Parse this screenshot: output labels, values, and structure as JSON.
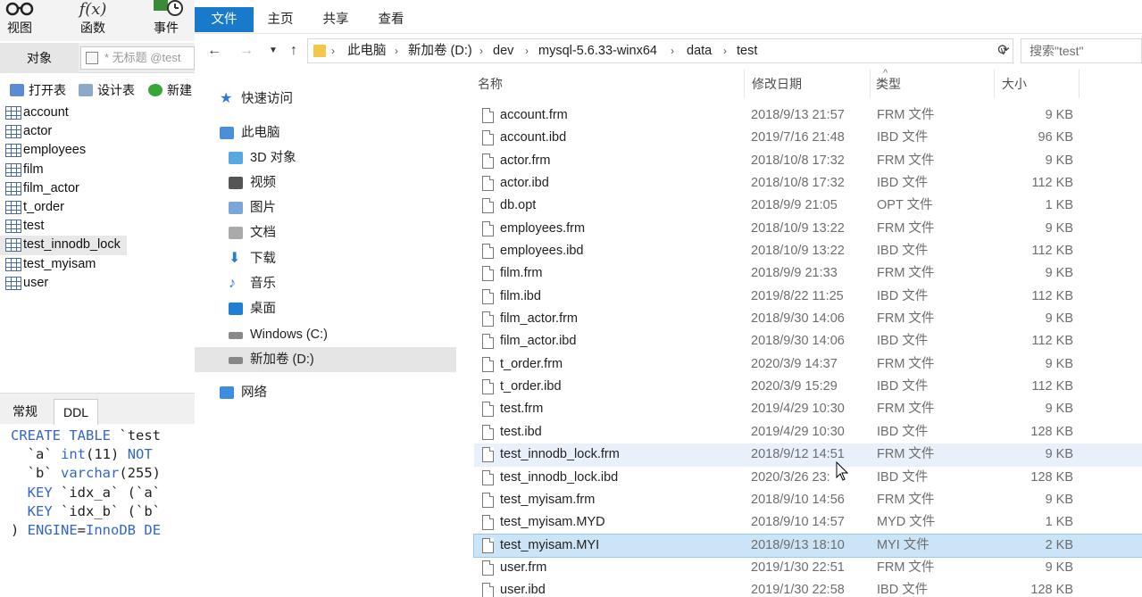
{
  "navicat": {
    "toolbar": [
      {
        "label": "视图",
        "icon": "glasses-icon"
      },
      {
        "label": "函数",
        "icon": "function-icon"
      },
      {
        "label": "事件",
        "icon": "clock-icon"
      }
    ],
    "object_tab": "对象",
    "table_tab_placeholder": "* 无标题 @test",
    "actions": [
      {
        "label": "打开表",
        "icon": "open-table-icon"
      },
      {
        "label": "设计表",
        "icon": "design-table-icon"
      },
      {
        "label": "新建",
        "icon": "new-table-icon"
      }
    ],
    "tables": [
      "account",
      "actor",
      "employees",
      "film",
      "film_actor",
      "t_order",
      "test",
      "test_innodb_lock",
      "test_myisam",
      "user"
    ],
    "selected_table": "test_innodb_lock",
    "bottom_tabs": [
      "常规",
      "DDL"
    ],
    "active_bottom_tab": "DDL",
    "ddl_lines": [
      "CREATE TABLE `test",
      "  `a` int(11) NOT ",
      "  `b` varchar(255)",
      "  KEY `idx_a` (`a`",
      "  KEY `idx_b` (`b`",
      ") ENGINE=InnoDB DE"
    ]
  },
  "explorer": {
    "ribbon_tabs": [
      "文件",
      "主页",
      "共享",
      "查看"
    ],
    "breadcrumb": [
      "此电脑",
      "新加卷 (D:)",
      "dev",
      "mysql-5.6.33-winx64",
      "data",
      "test"
    ],
    "search_placeholder": "搜索\"test\"",
    "nav": [
      {
        "label": "快速访问",
        "icon": "star-icon"
      },
      {
        "label": "此电脑",
        "icon": "computer-icon"
      },
      {
        "label": "3D 对象",
        "icon": "cube-icon"
      },
      {
        "label": "视频",
        "icon": "video-icon"
      },
      {
        "label": "图片",
        "icon": "picture-icon"
      },
      {
        "label": "文档",
        "icon": "document-icon"
      },
      {
        "label": "下载",
        "icon": "download-icon"
      },
      {
        "label": "音乐",
        "icon": "music-icon"
      },
      {
        "label": "桌面",
        "icon": "desktop-icon"
      },
      {
        "label": "Windows (C:)",
        "icon": "drive-icon"
      },
      {
        "label": "新加卷 (D:)",
        "icon": "drive-icon"
      },
      {
        "label": "网络",
        "icon": "network-icon"
      }
    ],
    "selected_nav": "新加卷 (D:)",
    "columns": {
      "name": "名称",
      "date": "修改日期",
      "type": "类型",
      "size": "大小"
    },
    "files": [
      {
        "name": "account.frm",
        "date": "2018/9/13 21:57",
        "type": "FRM 文件",
        "size": "9 KB"
      },
      {
        "name": "account.ibd",
        "date": "2019/7/16 21:48",
        "type": "IBD 文件",
        "size": "96 KB"
      },
      {
        "name": "actor.frm",
        "date": "2018/10/8 17:32",
        "type": "FRM 文件",
        "size": "9 KB"
      },
      {
        "name": "actor.ibd",
        "date": "2018/10/8 17:32",
        "type": "IBD 文件",
        "size": "112 KB"
      },
      {
        "name": "db.opt",
        "date": "2018/9/9 21:05",
        "type": "OPT 文件",
        "size": "1 KB"
      },
      {
        "name": "employees.frm",
        "date": "2018/10/9 13:22",
        "type": "FRM 文件",
        "size": "9 KB"
      },
      {
        "name": "employees.ibd",
        "date": "2018/10/9 13:22",
        "type": "IBD 文件",
        "size": "112 KB"
      },
      {
        "name": "film.frm",
        "date": "2018/9/9 21:33",
        "type": "FRM 文件",
        "size": "9 KB"
      },
      {
        "name": "film.ibd",
        "date": "2019/8/22 11:25",
        "type": "IBD 文件",
        "size": "112 KB"
      },
      {
        "name": "film_actor.frm",
        "date": "2018/9/30 14:06",
        "type": "FRM 文件",
        "size": "9 KB"
      },
      {
        "name": "film_actor.ibd",
        "date": "2018/9/30 14:06",
        "type": "IBD 文件",
        "size": "112 KB"
      },
      {
        "name": "t_order.frm",
        "date": "2020/3/9 14:37",
        "type": "FRM 文件",
        "size": "9 KB"
      },
      {
        "name": "t_order.ibd",
        "date": "2020/3/9 15:29",
        "type": "IBD 文件",
        "size": "112 KB"
      },
      {
        "name": "test.frm",
        "date": "2019/4/29 10:30",
        "type": "FRM 文件",
        "size": "9 KB"
      },
      {
        "name": "test.ibd",
        "date": "2019/4/29 10:30",
        "type": "IBD 文件",
        "size": "128 KB"
      },
      {
        "name": "test_innodb_lock.frm",
        "date": "2018/9/12 14:51",
        "type": "FRM 文件",
        "size": "9 KB"
      },
      {
        "name": "test_innodb_lock.ibd",
        "date": "2020/3/26 23:",
        "type": "IBD 文件",
        "size": "128 KB"
      },
      {
        "name": "test_myisam.frm",
        "date": "2018/9/10 14:56",
        "type": "FRM 文件",
        "size": "9 KB"
      },
      {
        "name": "test_myisam.MYD",
        "date": "2018/9/10 14:57",
        "type": "MYD 文件",
        "size": "1 KB"
      },
      {
        "name": "test_myisam.MYI",
        "date": "2018/9/13 18:10",
        "type": "MYI 文件",
        "size": "2 KB"
      },
      {
        "name": "user.frm",
        "date": "2019/1/30 22:51",
        "type": "FRM 文件",
        "size": "9 KB"
      },
      {
        "name": "user.ibd",
        "date": "2019/1/30 22:58",
        "type": "IBD 文件",
        "size": "128 KB"
      }
    ],
    "hover_file": "test_innodb_lock.frm",
    "selected_file": "test_myisam.MYI"
  }
}
